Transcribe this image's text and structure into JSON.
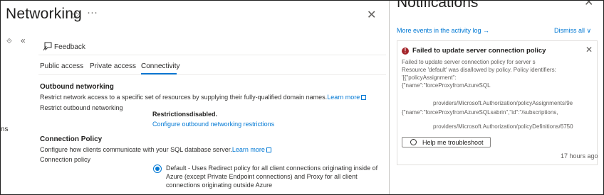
{
  "blade": {
    "title": "Networking",
    "star_glyph": "☆",
    "more_glyph": "···",
    "close_glyph": "✕",
    "left_icon_glyph": "⟐",
    "collapse_glyph": "«",
    "left_text": "ns",
    "feedback_label": "Feedback",
    "tabs": [
      {
        "label": "Public access"
      },
      {
        "label": "Private access"
      },
      {
        "label": "Connectivity",
        "active": true
      }
    ],
    "outbound": {
      "title": "Outbound networking",
      "description": "Restrict network access to a specific set of resources by supplying their fully-qualified domain names.",
      "learn_more": "Learn more",
      "field_label": "Restrict outbound networking",
      "status": "Restrictionsdisabled.",
      "configure_link": "Configure outbound networking restrictions"
    },
    "connection": {
      "title": "Connection Policy",
      "description": "Configure how clients communicate with your SQL database server.",
      "learn_more": "Learn more",
      "field_label": "Connection policy",
      "option_default": "Default - Uses Redirect policy for all client connections originating inside of Azure (except Private Endpoint connections) and Proxy for all client connections originating outside Azure"
    }
  },
  "notifications": {
    "title": "Notifications",
    "close_glyph": "✕",
    "more_events": "More events in the activity log →",
    "dismiss_all": "Dismiss all ∨",
    "card": {
      "error_glyph": "!",
      "title": "Failed to update server connection policy",
      "close_glyph": "✕",
      "lines": [
        "Failed to update server connection policy for server s",
        "Resource 'default' was disallowed by policy. Policy identifiers:",
        "'[{\"policyAssignment\":",
        "{\"name\":\"forceProxyfromAzureSQL",
        "",
        "providers/Microsoft.Authorization/policyAssignments/9e",
        "{\"name\":\"forceProxyfromAzureSQLsabrin\",\"id\":\"/subscriptions,",
        "",
        "providers/Microsoft.Authorization/policyDefinitions/6750"
      ],
      "button_label": "Help me troubleshoot",
      "time": "17 hours ago"
    }
  },
  "colors": {
    "accent": "#0078d4",
    "error": "#a4262c",
    "border": "#e1dfdd"
  }
}
